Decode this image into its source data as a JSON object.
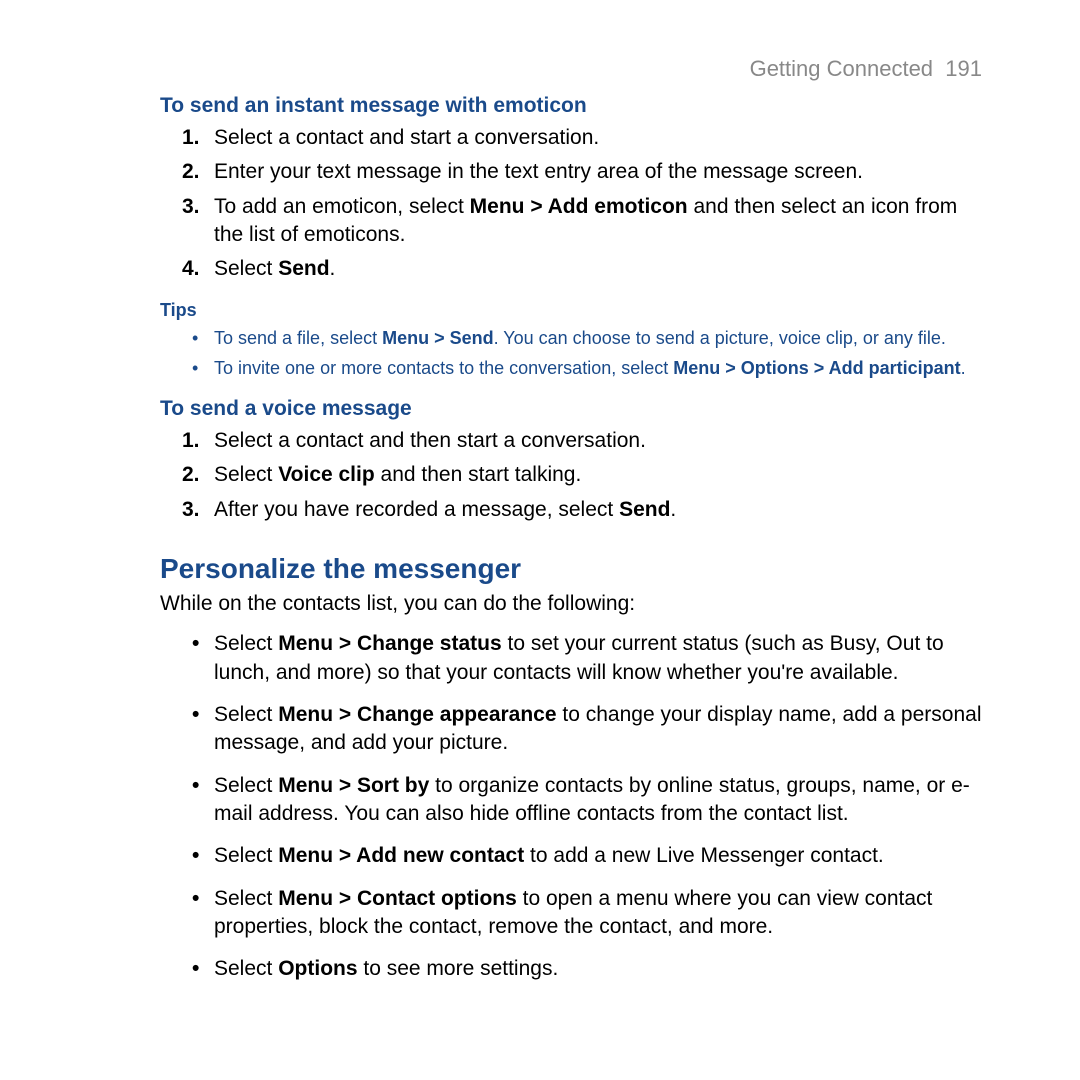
{
  "header": {
    "chapter": "Getting Connected",
    "page": "191"
  },
  "section1": {
    "heading": "To send an instant message with emoticon",
    "steps": [
      {
        "n": "1.",
        "text": "Select a contact and start a conversation."
      },
      {
        "n": "2.",
        "text": "Enter your text message in the text entry area of the message screen."
      },
      {
        "n": "3.",
        "pre": "To add an emoticon, select ",
        "bold": "Menu > Add emoticon",
        "post": " and then select an icon from the list of emoticons."
      },
      {
        "n": "4.",
        "pre": "Select ",
        "bold": "Send",
        "post": "."
      }
    ]
  },
  "tips": {
    "label": "Tips",
    "items": [
      {
        "pre": "To send a file, select ",
        "bold": "Menu > Send",
        "post": ". You can choose to send a picture, voice clip, or any file."
      },
      {
        "pre": "To invite one or more contacts to the conversation, select ",
        "bold": "Menu > Options > Add participant",
        "post": "."
      }
    ]
  },
  "section2": {
    "heading": "To send a voice message",
    "steps": [
      {
        "n": "1.",
        "text": "Select a contact and then start a conversation."
      },
      {
        "n": "2.",
        "pre": "Select ",
        "bold": "Voice clip",
        "post": " and then start talking."
      },
      {
        "n": "3.",
        "pre": "After you have recorded a message, select ",
        "bold": "Send",
        "post": "."
      }
    ]
  },
  "section3": {
    "title": "Personalize the messenger",
    "intro": "While on the contacts list, you can do the following:",
    "items": [
      {
        "pre": "Select ",
        "bold": "Menu > Change status",
        "post": " to set your current status (such as Busy, Out to lunch, and more) so that your contacts will know whether you're available."
      },
      {
        "pre": "Select ",
        "bold": "Menu > Change appearance",
        "post": " to change your display name, add a personal message, and add your picture."
      },
      {
        "pre": "Select ",
        "bold": "Menu > Sort by",
        "post": " to organize contacts by online status, groups, name, or e-mail address. You can also hide offline contacts from the contact list."
      },
      {
        "pre": "Select ",
        "bold": "Menu > Add new contact",
        "post": " to add a new Live Messenger contact."
      },
      {
        "pre": "Select ",
        "bold": "Menu > Contact options",
        "post": " to open a menu where you can view contact properties, block the contact, remove the contact, and more."
      },
      {
        "pre": "Select ",
        "bold": "Options",
        "post": " to see more settings."
      }
    ]
  }
}
